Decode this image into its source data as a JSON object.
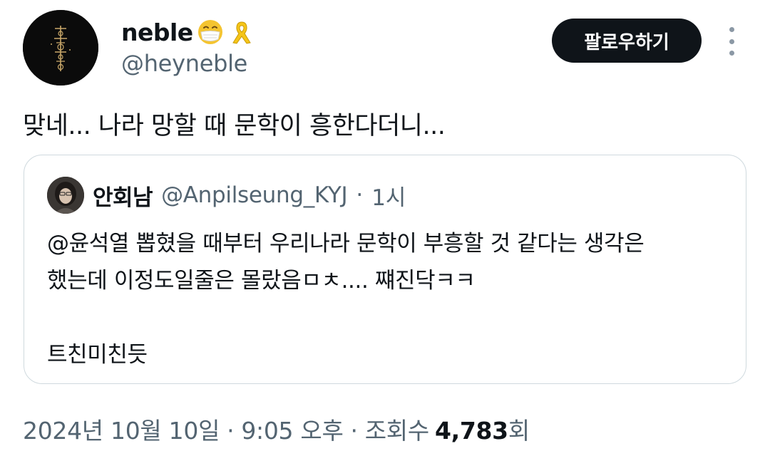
{
  "author": {
    "display_name": "neble",
    "emojis": [
      "mask-face-emoji",
      "yellow-ribbon-emoji"
    ],
    "handle": "@heyneble"
  },
  "follow_label": "팔로우하기",
  "tweet": {
    "text": "맞네... 나라 망할 때 문학이 흥한다더니..."
  },
  "quote": {
    "name": "안회남",
    "handle": "@Anpilseung_KYJ",
    "separator": "·",
    "time": "1시",
    "lines": [
      "@윤석열 뽑혔을 때부터 우리나라 문학이 부흥할 것 같다는 생각은",
      "했는데 이정도일줄은 몰랐음ㅁㅊ.... 쨰진닥ㅋㅋ",
      "",
      "트친미친듯"
    ]
  },
  "meta": {
    "date": "2024년 10월 10일",
    "separator": "·",
    "time": "9:05 오후",
    "views_label": "조회수",
    "views_count": "4,783",
    "views_suffix": "회"
  },
  "colors": {
    "text_primary": "#0f1419",
    "text_secondary": "#536471",
    "border": "#cfd9de",
    "button_bg": "#0f1419"
  }
}
